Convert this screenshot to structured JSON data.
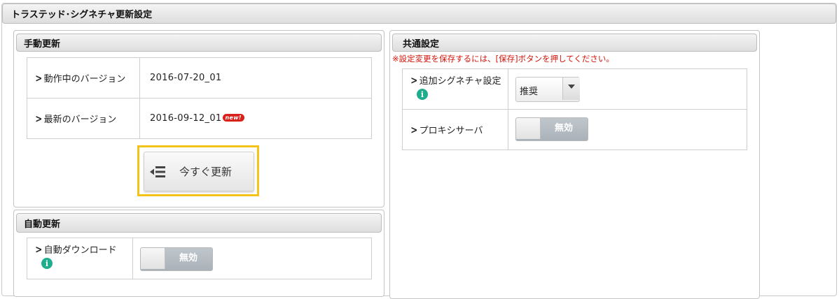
{
  "page_title": "トラステッド･シグネチャ更新設定",
  "manual": {
    "title": "手動更新",
    "rows": [
      {
        "label": "動作中のバージョン",
        "value": "2016-07-20_01"
      },
      {
        "label": "最新のバージョン",
        "value": "2016-09-12_01",
        "badge": "new!"
      }
    ],
    "update_button": "今すぐ更新"
  },
  "auto": {
    "title": "自動更新",
    "download_label": "自動ダウンロード",
    "download_toggle": "無効"
  },
  "common": {
    "title": "共通設定",
    "warning": "※設定変更を保存するには、[保存]ボタンを押してください。",
    "signature_label": "追加シグネチャ設定",
    "signature_value": "推奨",
    "proxy_label": "プロキシサーバ",
    "proxy_toggle": "無効"
  },
  "colors": {
    "highlight": "#f3c31a",
    "warning": "#d4140a",
    "info": "#1fae8d",
    "new_badge": "#d8211b"
  }
}
